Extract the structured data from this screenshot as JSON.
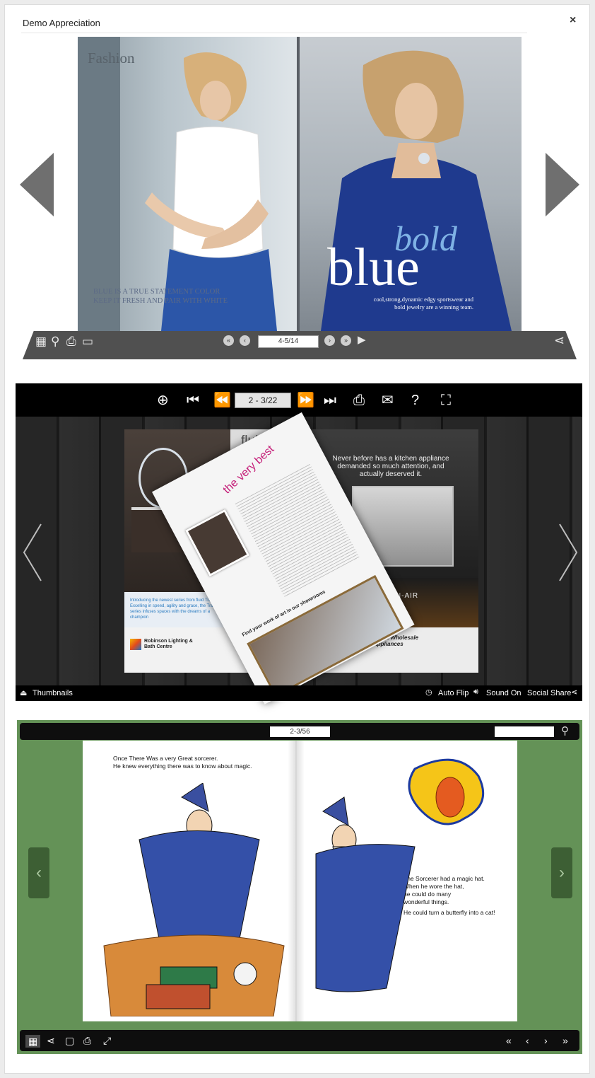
{
  "dialog": {
    "title": "Demo Appreciation",
    "close_label": "×"
  },
  "viewer1": {
    "left_page_heading": "Fashion",
    "left_page_text": "BLUE IS A TRUE STATEMENT COLOR   KEEP IT FRESH AND PAIR WITH WHITE",
    "right_page_word_italic": "bold",
    "right_page_word_large": "blue",
    "right_page_caption": "cool,strong,dynamic edgy sportswear and bold jewelry are a winning team.",
    "page_indicator": "4-5/14",
    "prev_arrow": "‹",
    "next_arrow": "›"
  },
  "viewer2": {
    "page_indicator": "2 - 3/22",
    "left_page_brand": "fluid",
    "left_page_flip_heading": "the very best",
    "left_page_promo": "Introducing the newest series from fluid Track. Excelling in speed, agility and grace, the Track series infuses spaces with the dreams of a champion",
    "left_page_company": "Robinson Lighting & Bath Centre",
    "right_page_headline": "Never before has a kitchen appliance demanded so much attention, and actually deserved it.",
    "right_page_brand": "JENN-AIR",
    "right_page_supplier": "Coast Wholesale Appliances",
    "flip_page_banner": "Find your work of art in our showrooms",
    "thumbnails_label": "Thumbnails",
    "auto_flip_label": "Auto Flip",
    "sound_label": "Sound On",
    "social_share_label": "Social Share"
  },
  "viewer3": {
    "page_indicator": "2-3/56",
    "left_text_line1": "Once There Was a very Great sorcerer.",
    "left_text_line2": "He knew everything there was to know about magic.",
    "right_text_line1": "The Sorcerer had a magic hat.",
    "right_text_line2": "When he wore the hat,",
    "right_text_line3": "he could do many",
    "right_text_line4": "wonderful things.",
    "right_text_line5": "He could turn a butterfly into a cat!"
  },
  "colors": {
    "viewer3_bg": "#649257",
    "viewer2_bar": "#000000",
    "viewer1_bar": "#505050"
  }
}
